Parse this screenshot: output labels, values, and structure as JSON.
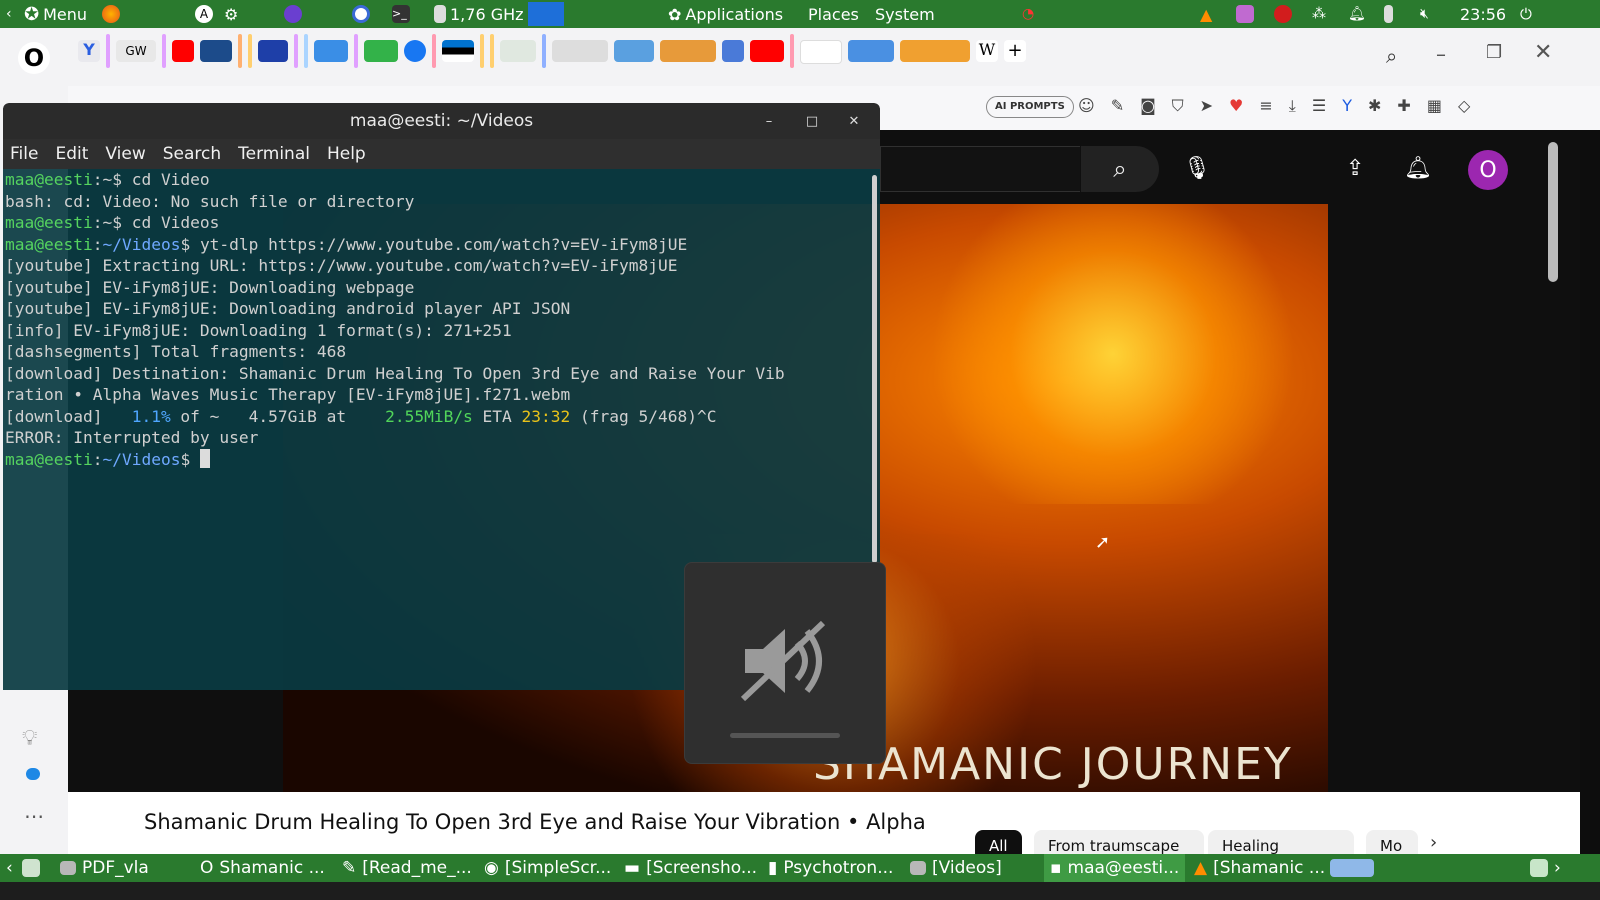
{
  "top_panel": {
    "menu_label": "Menu",
    "cpu_freq": "1,76 GHz",
    "applications": "Applications",
    "places": "Places",
    "system": "System",
    "clock": "23:56"
  },
  "browser": {
    "ai_prompts_label": "AI PROMPTS",
    "yt_search_placeholder": "Search",
    "avatar_letter": "O"
  },
  "terminal": {
    "title": "maa@eesti: ~/Videos",
    "menu": [
      "File",
      "Edit",
      "View",
      "Search",
      "Terminal",
      "Help"
    ],
    "prompt_user": "maa@eesti",
    "lines": {
      "l1_cmd": "cd Video",
      "l2": "bash: cd: Video: No such file or directory",
      "l3_cmd": "cd Videos",
      "l4_path": "~/Videos",
      "l4_cmd": "yt-dlp https://www.youtube.com/watch?v=EV-iFym8jUE",
      "l5": "[youtube] Extracting URL: https://www.youtube.com/watch?v=EV-iFym8jUE",
      "l6": "[youtube] EV-iFym8jUE: Downloading webpage",
      "l7": "[youtube] EV-iFym8jUE: Downloading android player API JSON",
      "l8": "[info] EV-iFym8jUE: Downloading 1 format(s): 271+251",
      "l9": "[dashsegments] Total fragments: 468",
      "l10": "[download] Destination: Shamanic Drum Healing To Open 3rd Eye and Raise Your Vib",
      "l11": "ration • Alpha Waves Music Therapy [EV-iFym8jUE].f271.webm",
      "l12_a": "[download]   ",
      "l12_pct": "1.1%",
      "l12_b": " of ~   4.57GiB at    ",
      "l12_speed": "2.55MiB/s",
      "l12_c": " ETA ",
      "l12_eta": "23:32",
      "l12_d": " (frag 5/468)^C",
      "l13": "ERROR: Interrupted by user",
      "l14_path": "~/Videos"
    }
  },
  "video": {
    "overlay_text": "SHAMANIC JOURNEY",
    "title": "Shamanic Drum Healing To Open 3rd Eye and Raise Your Vibration • Alpha",
    "chips": [
      "All",
      "From traumscape",
      "Healing prayers",
      "Mo"
    ]
  },
  "taskbar": {
    "items": [
      "PDF_vla",
      "Shamanic ...",
      "[Read_me_...",
      "[SimpleScr...",
      "[Screensho...",
      "Psychotron...",
      "[Videos]",
      "maa@eesti...",
      "[Shamanic ..."
    ]
  }
}
